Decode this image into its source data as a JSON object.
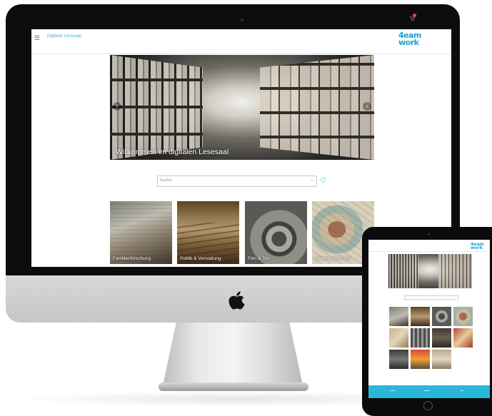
{
  "desktop": {
    "app_title": "Digitaler Lesesaal",
    "logo_line1": "4eam",
    "logo_line2": "work",
    "hero_caption": "Willkommen im digitalen Lesesaal",
    "search_placeholder": "Suchen",
    "categories": [
      {
        "label": "Familienforschung"
      },
      {
        "label": "Politik & Verwaltung"
      },
      {
        "label": "Film & Ton"
      },
      {
        "label": "Karten und Pläne"
      }
    ]
  },
  "tablet": {
    "logo_line1": "4eam",
    "logo_line2": "work"
  },
  "colors": {
    "accent": "#1aa3d4",
    "footer": "#2ab7d9",
    "badge": "#e04a3a"
  },
  "icons": [
    "menu-icon",
    "cart-icon",
    "chevron-left-icon",
    "chevron-right-icon",
    "chevron-down-icon",
    "lightbulb-icon",
    "apple-logo"
  ]
}
